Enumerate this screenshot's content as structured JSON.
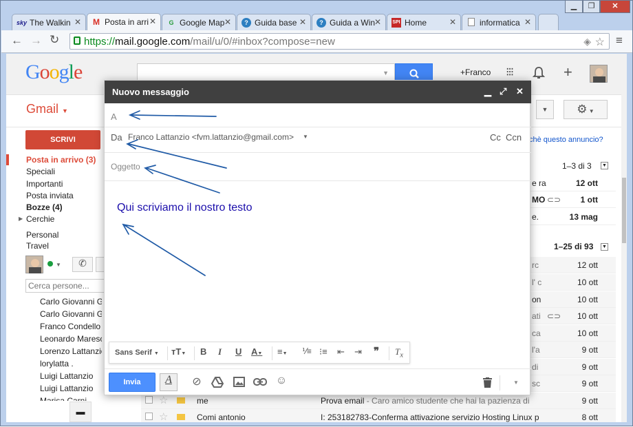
{
  "browser": {
    "tabs": [
      {
        "title": "The Walkin",
        "fav": "sky",
        "active": false
      },
      {
        "title": "Posta in arri",
        "fav": "M",
        "active": true
      },
      {
        "title": "Google Map",
        "fav": "G",
        "active": false
      },
      {
        "title": "Guida base",
        "fav": "?",
        "active": false
      },
      {
        "title": "Guida a Win",
        "fav": "?",
        "active": false
      },
      {
        "title": "Home",
        "fav": "SPI",
        "active": false
      },
      {
        "title": "informatica",
        "fav": "",
        "active": false
      }
    ],
    "url_scheme": "https://",
    "url_host": "mail.google.com",
    "url_path": "/mail/u/0/#inbox?compose=new"
  },
  "gmail": {
    "logo": "Google",
    "account_name": "+Franco",
    "app_label": "Gmail",
    "compose_label": "SCRIVI",
    "ad_link": "chè questo annuncio?",
    "pager_top": "1–3 di 3",
    "pager_bottom": "1–25 di 93",
    "nav": [
      "Posta in arrivo (3)",
      "Speciali",
      "Importanti",
      "Posta inviata",
      "Bozze (4)",
      "Cerchie",
      "Personal",
      "Travel"
    ],
    "people_search_placeholder": "Cerca persone...",
    "contacts": [
      "Carlo Giovanni G",
      "Carlo Giovanni G",
      "Franco Condello",
      "Leonardo Maresc",
      "Lorenzo Lattanzio",
      "lorylatta .",
      "Luigi Lattanzio",
      "Luigi Lattanzio",
      "Marisa Carni"
    ],
    "rows_top": [
      {
        "snippet": "e ra",
        "date": "12 ott",
        "bold": true
      },
      {
        "snippet": "MO",
        "date": "1 ott",
        "bold": true,
        "clip": true
      },
      {
        "snippet": "e.",
        "date": "13 mag",
        "bold": true
      }
    ],
    "rows_bottom": [
      {
        "snippet": "rc",
        "date": "12 ott"
      },
      {
        "snippet": "l' c",
        "date": "10 ott"
      },
      {
        "snippet": "on",
        "date": "10 ott",
        "bold_snip": true
      },
      {
        "snippet": "ati",
        "date": "10 ott",
        "clip": true
      },
      {
        "snippet": "ca",
        "date": "10 ott"
      },
      {
        "snippet": "l'a",
        "date": "9 ott"
      },
      {
        "snippet": "di",
        "date": "9 ott"
      },
      {
        "snippet": "sc",
        "date": "9 ott"
      },
      {
        "snippet": "pi",
        "date": "9 ott"
      }
    ],
    "row_me": {
      "sender": "me",
      "subject": "Prova email",
      "snippet": " - Caro amico studente che hai la pazienza di",
      "date": "9 ott"
    },
    "row_comi": {
      "sender": "Comi antonio",
      "subject": "I: 253182783-Conferma attivazione servizio Hosting Linux p",
      "date": "8 ott"
    }
  },
  "compose": {
    "title": "Nuovo messaggio",
    "to_label": "A",
    "from_label": "Da",
    "from_value": "Franco Lattanzio <fvm.lattanzio@gmail.com>",
    "cc": "Cc",
    "bcc": "Ccn",
    "subject_placeholder": "Oggetto",
    "body_text": "Qui scriviamo il nostro testo",
    "font_name": "Sans Serif",
    "send_label": "Invia",
    "accent": "#4d90fe",
    "annotation_color": "#1f5aa6"
  }
}
